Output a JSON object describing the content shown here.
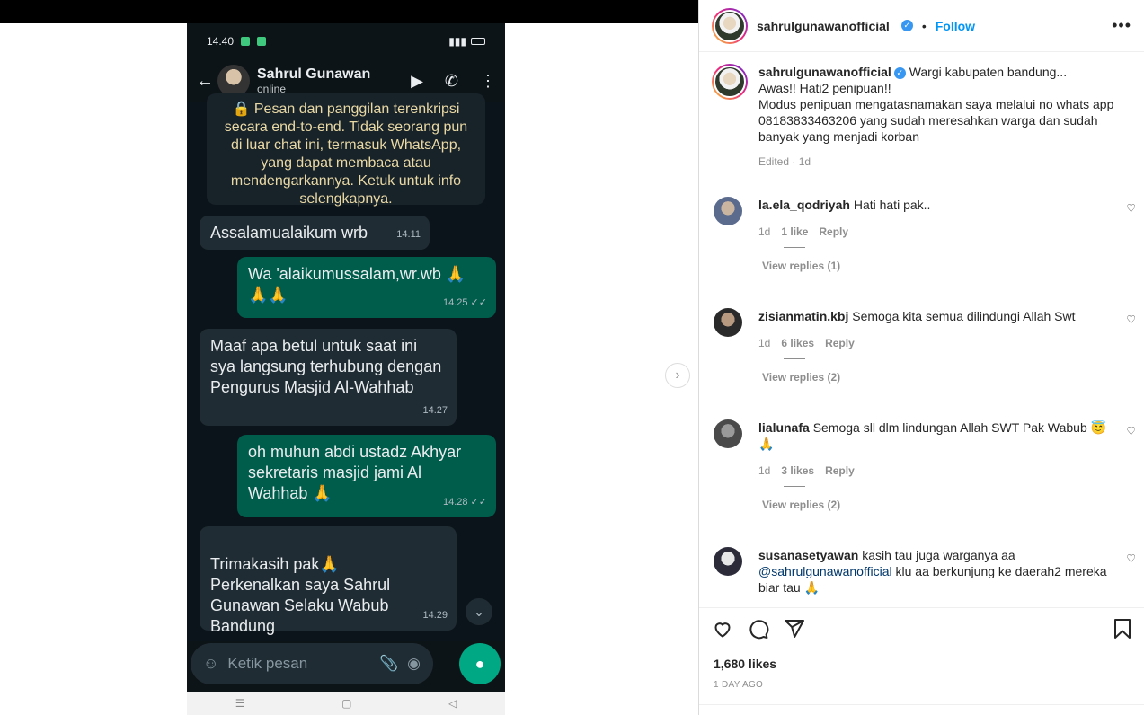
{
  "screenshot": {
    "status_time": "14.40",
    "contact_name": "Sahrul Gunawan",
    "contact_status": "online",
    "messages": [
      {
        "text": "🔒 Pesan dan panggilan terenkripsi secara end-to-end. Tidak seorang pun di luar chat ini, termasuk WhatsApp, yang dapat membaca atau mendengarkannya. Ketuk untuk info selengkapnya."
      },
      {
        "text": "Assalamualaikum wrb",
        "time": "14.11"
      },
      {
        "text": "Wa 'alaikumussalam,wr.wb 🙏🙏🙏",
        "time": "14.25 ✓✓"
      },
      {
        "text": "Maaf apa betul untuk saat ini sya langsung terhubung dengan Pengurus Masjid Al-Wahhab",
        "time": "14.27"
      },
      {
        "text": "oh muhun abdi ustadz Akhyar sekretaris masjid jami Al Wahhab 🙏",
        "time": "14.28 ✓✓"
      },
      {
        "text": "Trimakasih pak🙏\nPerkenalkan saya Sahrul Gunawan Selaku Wabub Bandung",
        "time": "14.29"
      }
    ],
    "compose_placeholder": "Ketik pesan"
  },
  "post": {
    "author": "sahrulgunawanofficial",
    "follow_label": "Follow",
    "caption_lead": "Wargi kabupaten bandung...",
    "caption_lines": [
      "Awas!! Hati2 penipuan!!",
      "Modus penipuan mengatasnamakan saya melalui no whats app 08183833463206 yang sudah meresahkan warga dan sudah banyak yang menjadi korban"
    ],
    "caption_meta": "Edited · 1d",
    "likes": "1,680 likes",
    "time_ago": "1 DAY AGO"
  },
  "comments": [
    {
      "user": "la.ela_qodriyah",
      "text": "Hati hati pak..",
      "age": "1d",
      "likes": "1 like",
      "reply": "Reply",
      "view_replies": "View replies (1)",
      "avatar_color": "#5b6b8e"
    },
    {
      "user": "zisianmatin.kbj",
      "text": "Semoga kita semua dilindungi Allah Swt",
      "age": "1d",
      "likes": "6 likes",
      "reply": "Reply",
      "view_replies": "View replies (2)",
      "avatar_color": "#2a2a2a"
    },
    {
      "user": "lialunafa",
      "text": "Semoga sll dlm lindungan Allah SWT Pak Wabub 😇🙏",
      "age": "1d",
      "likes": "3 likes",
      "reply": "Reply",
      "view_replies": "View replies (2)",
      "avatar_color": "#6f6f6f"
    },
    {
      "user": "susanasetyawan",
      "text": "kasih tau juga warganya aa",
      "mention": "@sahrulgunawanofficial",
      "text2": "klu aa berkunjung ke daerah2 mereka biar tau 🙏",
      "avatar_color": "#8aa0a6"
    }
  ]
}
